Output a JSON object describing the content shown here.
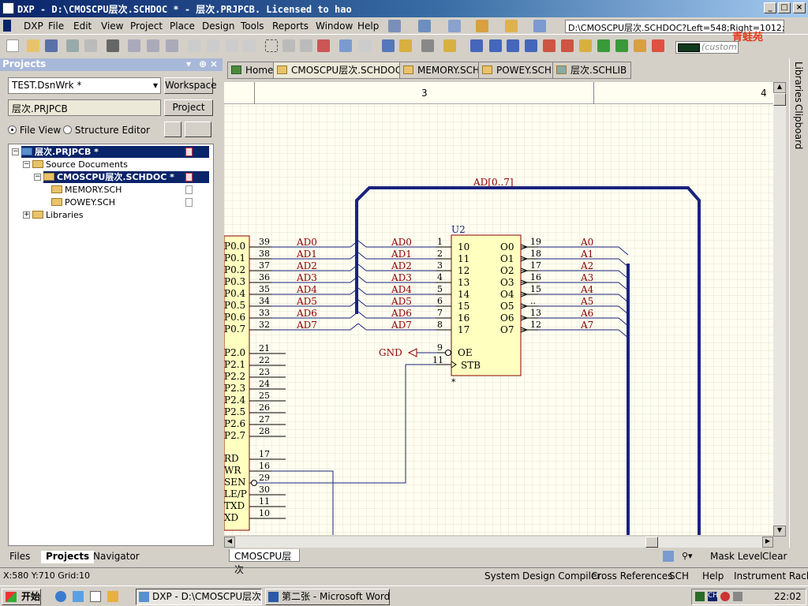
{
  "window": {
    "title": "DXP - D:\\CMOSCPU层次.SCHDOC * - 层次.PRJPCB. Licensed to hao",
    "min": "_",
    "max": "□",
    "close": "×"
  },
  "menu": [
    "DXP",
    "File",
    "Edit",
    "View",
    "Project",
    "Place",
    "Design",
    "Tools",
    "Reports",
    "Window",
    "Help"
  ],
  "path_box": "D:\\CMOSCPU层次.SCHDOC?Left=548;Right=1012;To",
  "custom_box": "(custom",
  "logo_text": "青蛙苑",
  "panel": {
    "title": "Projects",
    "workspace_combo": "TEST.DsnWrk *",
    "workspace_btn": "Workspace",
    "project_combo": "层次.PRJPCB",
    "project_btn": "Project",
    "file_view": "File View",
    "structure_editor": "Structure Editor",
    "tree": {
      "root": "层次.PRJPCB *",
      "source": "Source Documents",
      "doc1": "CMOSCPU层次.SCHDOC *",
      "doc2": "MEMORY.SCH",
      "doc3": "POWEY.SCH",
      "libs": "Libraries"
    },
    "tabs": [
      "Files",
      "Projects",
      "Navigator"
    ]
  },
  "doc_tabs": [
    "Home",
    "CMOSCPU层次.SCHDOC *",
    "MEMORY.SCH",
    "POWEY.SCH",
    "层次.SCHLIB"
  ],
  "ruler": {
    "col3": "3",
    "col4": "4"
  },
  "right_panels": [
    "Libraries",
    "Clipboard"
  ],
  "schematic": {
    "bus_label": "AD[0..7]",
    "u2_ref": "U2",
    "mcu_pins": [
      "P0.0",
      "P0.1",
      "P0.2",
      "P0.3",
      "P0.4",
      "P0.5",
      "P0.6",
      "P0.7"
    ],
    "mcu_pin_nums": [
      "39",
      "38",
      "37",
      "36",
      "35",
      "34",
      "33",
      "32"
    ],
    "net_left": [
      "AD0",
      "AD1",
      "AD2",
      "AD3",
      "AD4",
      "AD5",
      "AD6",
      "AD7"
    ],
    "net_mid": [
      "AD0",
      "AD1",
      "AD2",
      "AD3",
      "AD4",
      "AD5",
      "AD6",
      "AD7"
    ],
    "u2_in_nums": [
      "1",
      "2",
      "3",
      "4",
      "5",
      "6",
      "7",
      "8"
    ],
    "u2_in_pins": [
      "10",
      "11",
      "12",
      "13",
      "14",
      "15",
      "16",
      "17"
    ],
    "u2_out_pins": [
      "O0",
      "O1",
      "O2",
      "O3",
      "O4",
      "O5",
      "O6",
      "O7"
    ],
    "u2_out_nums": [
      "19",
      "18",
      "17",
      "16",
      "15",
      "..",
      "13",
      "12"
    ],
    "net_out": [
      "A0",
      "A1",
      "A2",
      "A3",
      "A4",
      "A5",
      "A6",
      "A7"
    ],
    "p2_pins": [
      "P2.0",
      "P2.1",
      "P2.2",
      "P2.3",
      "P2.4",
      "P2.5",
      "P2.6",
      "P2.7"
    ],
    "p2_nums": [
      "21",
      "22",
      "23",
      "24",
      "25",
      "26",
      "27",
      "28"
    ],
    "ctrl_pins": [
      "RD",
      "WR",
      "SEN",
      "LE/P",
      "TXD",
      "XD"
    ],
    "ctrl_nums": [
      "17",
      "16",
      "29",
      "30",
      "11",
      "10"
    ],
    "gnd": "GND",
    "oe_num": "9",
    "oe": "OE",
    "stb_num": "11",
    "stb": "STB",
    "star": "*"
  },
  "sheet_tab": "CMOSCPU层次",
  "mask": {
    "level": "Mask Level",
    "clear": "Clear"
  },
  "status": {
    "coords": "X:580 Y:710   Grid:10"
  },
  "status_buttons": [
    "System",
    "Design Compiler",
    "Cross References",
    "SCH",
    "Help",
    "Instrument Racks"
  ],
  "taskbar": {
    "start": "开始",
    "tasks": [
      "DXP - D:\\CMOSCPU层次....",
      "第二张 - Microsoft Word"
    ],
    "clock": "22:02"
  }
}
